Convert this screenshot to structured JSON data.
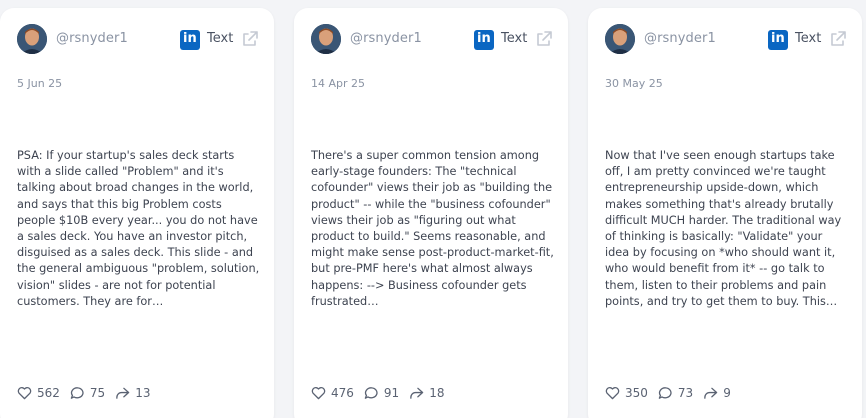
{
  "posts": [
    {
      "handle": "@rsnyder1",
      "platform_label": "Text",
      "date": "5 Jun 25",
      "body": "PSA: If your startup's sales deck starts with a slide called \"Problem\" and it's talking about broad changes in the world, and says that this big Problem costs people $10B every year... you do not have a sales deck. You have an investor pitch, disguised as a sales deck. This slide - and the general ambiguous \"problem, solution, vision\" slides - are not for potential customers. They are for…",
      "likes": "562",
      "comments": "75",
      "shares": "13"
    },
    {
      "handle": "@rsnyder1",
      "platform_label": "Text",
      "date": "14 Apr 25",
      "body": "There's a super common tension among early-stage founders: The \"technical cofounder\" views their job as \"building the product\" -- while the \"business cofounder\" views their job as \"figuring out what product to build.\" Seems reasonable, and might make sense post-product-market-fit, but pre-PMF here's what almost always happens: --> Business cofounder gets frustrated…",
      "likes": "476",
      "comments": "91",
      "shares": "18"
    },
    {
      "handle": "@rsnyder1",
      "platform_label": "Text",
      "date": "30 May 25",
      "body": "Now that I've seen enough startups take off, I am pretty convinced we're taught entrepreneurship upside-down, which makes something that's already brutally difficult MUCH harder. The traditional way of thinking is basically: \"Validate\" your idea by focusing on *who should want it, who would benefit from it* -- go talk to them, listen to their problems and pain points, and try to get them to buy. This…",
      "likes": "350",
      "comments": "73",
      "shares": "9"
    }
  ],
  "icons": {
    "platform": "linkedin-icon",
    "open": "external-link-icon",
    "likes": "heart-icon",
    "comments": "comment-bubble-icon",
    "shares": "share-arrow-icon"
  },
  "colors": {
    "linkedin": "#0a66c2",
    "background": "#f3f4f7",
    "card": "#ffffff"
  }
}
